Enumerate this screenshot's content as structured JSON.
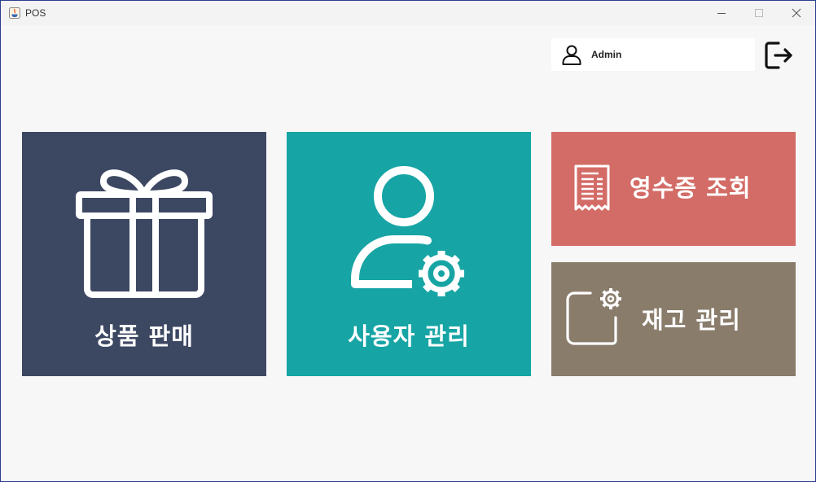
{
  "window": {
    "title": "POS",
    "app_icon": "java-cup-icon",
    "controls": [
      "minimize-icon",
      "maximize-icon",
      "close-icon"
    ]
  },
  "user": {
    "name": "Admin",
    "icon": "user-icon",
    "logout_icon": "logout-icon"
  },
  "tiles": [
    {
      "label": "상품 판매",
      "icon": "gift-icon",
      "color": "#3c4762"
    },
    {
      "label": "사용자 관리",
      "icon": "user-settings-icon",
      "color": "#17a4a4"
    },
    {
      "label": "영수증 조회",
      "icon": "receipt-icon",
      "color": "#d36c67"
    },
    {
      "label": "재고 관리",
      "icon": "inventory-settings-icon",
      "color": "#8a7c6b"
    }
  ]
}
